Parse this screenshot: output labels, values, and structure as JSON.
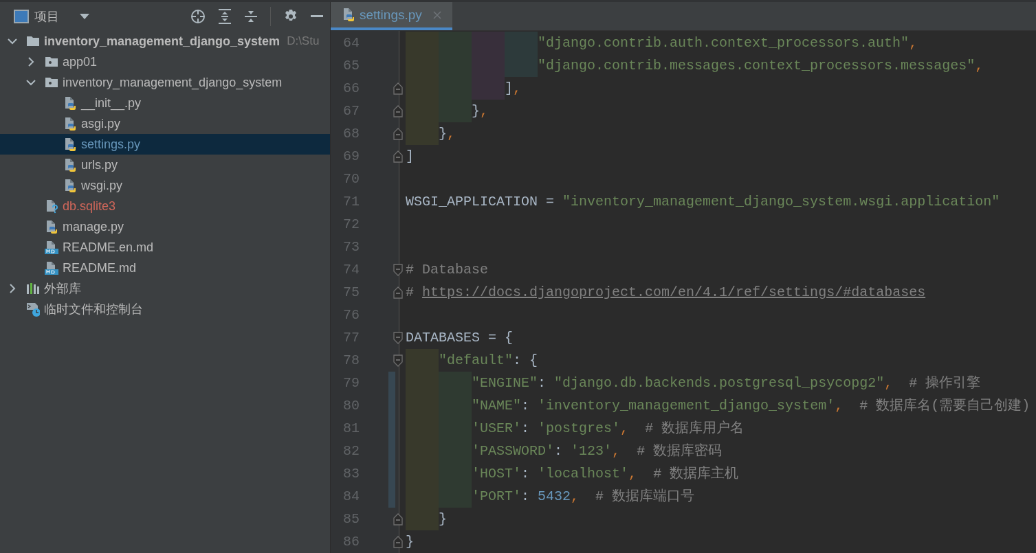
{
  "sidebar": {
    "header": {
      "title": "项目"
    },
    "tree": [
      {
        "label": "inventory_management_django_system",
        "hint": "D:\\Stu",
        "kind": "folder",
        "color": "#bbbbbb",
        "expanded": true,
        "selected": false,
        "children": [
          {
            "label": "app01",
            "kind": "module",
            "color": "#bbbbbb",
            "expanded": false,
            "selected": false
          },
          {
            "label": "inventory_management_django_system",
            "kind": "module",
            "color": "#bbbbbb",
            "expanded": true,
            "selected": false,
            "children": [
              {
                "label": "__init__.py",
                "kind": "python",
                "color": "#bbbbbb",
                "selected": false
              },
              {
                "label": "asgi.py",
                "kind": "python",
                "color": "#bbbbbb",
                "selected": false
              },
              {
                "label": "settings.py",
                "kind": "python",
                "color": "#6897bb",
                "selected": true
              },
              {
                "label": "urls.py",
                "kind": "python",
                "color": "#bbbbbb",
                "selected": false
              },
              {
                "label": "wsgi.py",
                "kind": "python",
                "color": "#bbbbbb",
                "selected": false
              }
            ]
          },
          {
            "label": "db.sqlite3",
            "kind": "unknown",
            "color": "#d1675a",
            "selected": false
          },
          {
            "label": "manage.py",
            "kind": "python",
            "color": "#bbbbbb",
            "selected": false
          },
          {
            "label": "README.en.md",
            "kind": "markdown",
            "color": "#bbbbbb",
            "selected": false
          },
          {
            "label": "README.md",
            "kind": "markdown",
            "color": "#bbbbbb",
            "selected": false
          }
        ]
      },
      {
        "label": "外部库",
        "kind": "library",
        "color": "#bbbbbb",
        "expanded": false,
        "selected": false
      },
      {
        "label": "临时文件和控制台",
        "kind": "scratch",
        "color": "#bbbbbb",
        "selected": false
      }
    ]
  },
  "editor": {
    "tabs": [
      {
        "label": "settings.py",
        "kind": "python",
        "color": "#6897bb",
        "selected": true
      }
    ],
    "lines": [
      {
        "number": "64",
        "fold_start": false,
        "fold_end": false,
        "changed": false,
        "tokens": [
          {
            "kind": "string",
            "text": "                \"django.contrib.auth.context_processors.auth\""
          },
          {
            "kind": "comma",
            "text": ","
          }
        ]
      },
      {
        "number": "65",
        "fold_start": false,
        "fold_end": false,
        "changed": false,
        "tokens": [
          {
            "kind": "string",
            "text": "                \"django.contrib.messages.context_processors.messages\""
          },
          {
            "kind": "comma",
            "text": ","
          }
        ]
      },
      {
        "number": "66",
        "fold_start": false,
        "fold_end": true,
        "changed": false,
        "tokens": [
          {
            "kind": "plain",
            "text": "            ]"
          },
          {
            "kind": "comma",
            "text": ","
          }
        ]
      },
      {
        "number": "67",
        "fold_start": false,
        "fold_end": true,
        "changed": false,
        "tokens": [
          {
            "kind": "plain",
            "text": "        }"
          },
          {
            "kind": "comma",
            "text": ","
          }
        ]
      },
      {
        "number": "68",
        "fold_start": false,
        "fold_end": true,
        "changed": false,
        "tokens": [
          {
            "kind": "plain",
            "text": "    }"
          },
          {
            "kind": "comma",
            "text": ","
          }
        ]
      },
      {
        "number": "69",
        "fold_start": false,
        "fold_end": true,
        "changed": false,
        "tokens": [
          {
            "kind": "plain",
            "text": "]"
          }
        ]
      },
      {
        "number": "70",
        "fold_start": false,
        "fold_end": false,
        "changed": false
      },
      {
        "number": "71",
        "fold_start": false,
        "fold_end": false,
        "changed": false,
        "tokens": [
          {
            "kind": "plain",
            "text": "WSGI_APPLICATION ="
          },
          {
            "kind": "string",
            "text": " \"inventory_management_django_system.wsgi.application\""
          }
        ]
      },
      {
        "number": "72",
        "fold_start": false,
        "fold_end": false,
        "changed": false
      },
      {
        "number": "73",
        "fold_start": false,
        "fold_end": false,
        "changed": false
      },
      {
        "number": "74",
        "fold_start": true,
        "fold_end": false,
        "changed": false,
        "tokens": [
          {
            "kind": "comment",
            "text": "# Database"
          }
        ]
      },
      {
        "number": "75",
        "fold_start": false,
        "fold_end": true,
        "changed": false,
        "tokens": [
          {
            "kind": "comment",
            "text": "#"
          },
          {
            "kind": "link",
            "text": " https://docs.djangoproject.com/en/4.1/ref/settings/#databases"
          }
        ]
      },
      {
        "number": "76",
        "fold_start": false,
        "fold_end": false,
        "changed": false
      },
      {
        "number": "77",
        "fold_start": true,
        "fold_end": false,
        "changed": false,
        "tokens": [
          {
            "kind": "plain",
            "text": "DATABASES = {"
          }
        ]
      },
      {
        "number": "78",
        "fold_start": true,
        "fold_end": false,
        "changed": false,
        "tokens": [
          {
            "kind": "string",
            "text": "    \"default\""
          },
          {
            "kind": "plain",
            "text": ": {"
          }
        ]
      },
      {
        "number": "79",
        "fold_start": false,
        "fold_end": false,
        "changed": true,
        "tokens": [
          {
            "kind": "string",
            "text": "        \"ENGINE\""
          },
          {
            "kind": "plain",
            "text": ":"
          },
          {
            "kind": "string",
            "text": " \"django.db.backends.postgresql_psycopg2\""
          },
          {
            "kind": "comma",
            "text": ","
          },
          {
            "kind": "comment",
            "text": "  # 操作引擎"
          }
        ]
      },
      {
        "number": "80",
        "fold_start": false,
        "fold_end": false,
        "changed": true,
        "tokens": [
          {
            "kind": "string",
            "text": "        \"NAME\""
          },
          {
            "kind": "plain",
            "text": ":"
          },
          {
            "kind": "string",
            "text": " 'inventory_management_django_system'"
          },
          {
            "kind": "comma",
            "text": ","
          },
          {
            "kind": "comment",
            "text": "  # 数据库名(需要自己创建)"
          }
        ]
      },
      {
        "number": "81",
        "fold_start": false,
        "fold_end": false,
        "changed": true,
        "tokens": [
          {
            "kind": "string",
            "text": "        'USER'"
          },
          {
            "kind": "plain",
            "text": ":"
          },
          {
            "kind": "string",
            "text": " 'postgres'"
          },
          {
            "kind": "comma",
            "text": ","
          },
          {
            "kind": "comment",
            "text": "  # 数据库用户名"
          }
        ]
      },
      {
        "number": "82",
        "fold_start": false,
        "fold_end": false,
        "changed": true,
        "tokens": [
          {
            "kind": "string",
            "text": "        'PASSWORD'"
          },
          {
            "kind": "plain",
            "text": ":"
          },
          {
            "kind": "string",
            "text": " '123'"
          },
          {
            "kind": "comma",
            "text": ","
          },
          {
            "kind": "comment",
            "text": "  # 数据库密码"
          }
        ]
      },
      {
        "number": "83",
        "fold_start": false,
        "fold_end": false,
        "changed": true,
        "tokens": [
          {
            "kind": "string",
            "text": "        'HOST'"
          },
          {
            "kind": "plain",
            "text": ":"
          },
          {
            "kind": "string",
            "text": " 'localhost'"
          },
          {
            "kind": "comma",
            "text": ","
          },
          {
            "kind": "comment",
            "text": "  # 数据库主机"
          }
        ]
      },
      {
        "number": "84",
        "fold_start": false,
        "fold_end": false,
        "changed": true,
        "tokens": [
          {
            "kind": "string",
            "text": "        'PORT'"
          },
          {
            "kind": "plain",
            "text": ":"
          },
          {
            "kind": "number",
            "text": " 5432"
          },
          {
            "kind": "comma",
            "text": ","
          },
          {
            "kind": "comment",
            "text": "  # 数据库端口号"
          }
        ]
      },
      {
        "number": "85",
        "fold_start": false,
        "fold_end": true,
        "changed": false,
        "tokens": [
          {
            "kind": "plain",
            "text": "    }"
          }
        ]
      },
      {
        "number": "86",
        "fold_start": false,
        "fold_end": true,
        "changed": false,
        "tokens": [
          {
            "kind": "plain",
            "text": "}"
          }
        ]
      }
    ]
  }
}
